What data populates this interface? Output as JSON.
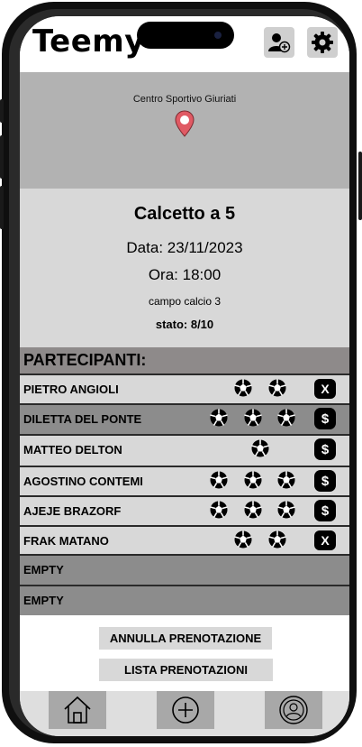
{
  "app": {
    "name": "Teemy"
  },
  "header": {
    "add_friend_icon": "add-user-icon",
    "settings_icon": "gear-icon"
  },
  "map": {
    "location_label": "Centro Sportivo Giuriati",
    "pin_color": "#e05a64"
  },
  "match": {
    "title": "Calcetto a 5",
    "date": "Data: 23/11/2023",
    "time": "Ora: 18:00",
    "field": "campo calcio 3",
    "status": "stato: 8/10"
  },
  "participants": {
    "heading": "PARTECIPANTI:",
    "rows": [
      {
        "name": "PIETRO ANGIOLI",
        "balls": 2,
        "action": "X"
      },
      {
        "name": "DILETTA DEL PONTE",
        "balls": 3,
        "action": "$"
      },
      {
        "name": "MATTEO DELTON",
        "balls": 1,
        "action": "$"
      },
      {
        "name": "AGOSTINO CONTEMI",
        "balls": 3,
        "action": "$"
      },
      {
        "name": "AJEJE BRAZORF",
        "balls": 3,
        "action": "$"
      },
      {
        "name": "FRAK MATANO",
        "balls": 2,
        "action": "X"
      },
      {
        "name": "EMPTY",
        "balls": 0,
        "action": ""
      },
      {
        "name": "EMPTY",
        "balls": 0,
        "action": ""
      }
    ]
  },
  "actions": {
    "cancel_label": "ANNULLA PRENOTAZIONE",
    "list_label": "LISTA PRENOTAZIONI"
  },
  "tabbar": {
    "items": [
      "home-icon",
      "plus-circle-icon",
      "profile-icon"
    ]
  }
}
